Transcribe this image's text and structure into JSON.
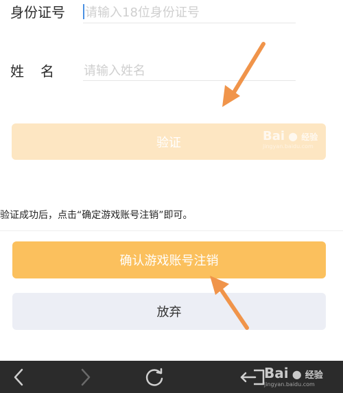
{
  "form": {
    "id_label": "身份证号",
    "id_placeholder": "请输入18位身份证号",
    "name_label": "姓　名",
    "name_placeholder": "请输入姓名",
    "verify_button": "验证"
  },
  "instruction": "验证成功后，点击“确定游戏账号注销”即可。",
  "actions": {
    "confirm_button": "确认游戏账号注销",
    "give_up_button": "放弃"
  },
  "watermark": {
    "text": "Bai",
    "suffix": "经验",
    "sub": "jingyan.baidu.com"
  },
  "colors": {
    "accent": "#fbc05d",
    "accent_disabled": "#fde6c2",
    "arrow": "#f0944a",
    "nav_bg": "#2b2b2b"
  },
  "icons": {
    "nav": [
      "back-icon",
      "forward-icon",
      "refresh-icon",
      "exit-icon"
    ],
    "annotation": [
      "arrow-annotation-icon"
    ]
  }
}
